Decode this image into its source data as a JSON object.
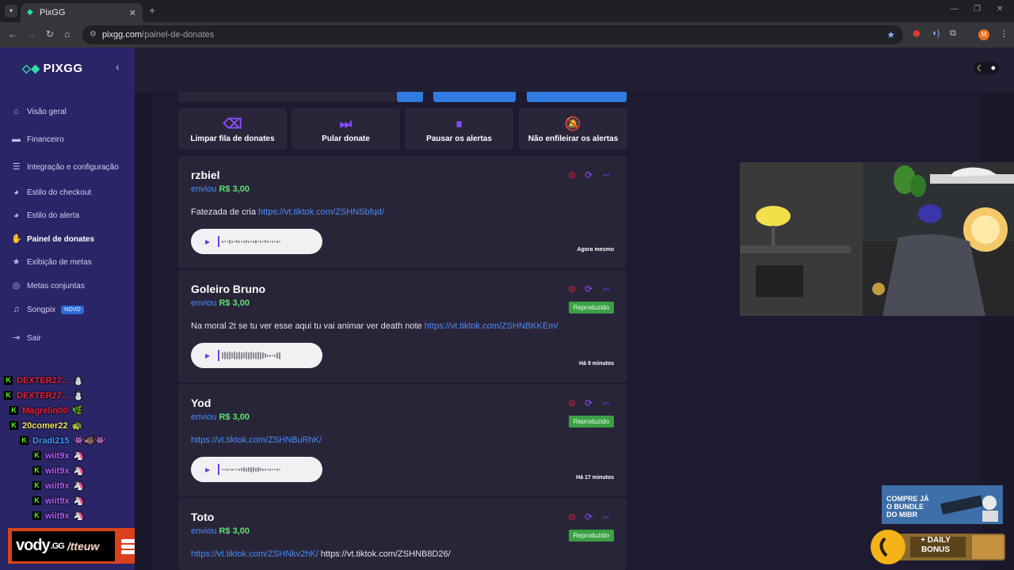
{
  "browser": {
    "tab_title": "PixGG",
    "url_host": "pixgg.com",
    "url_path": "/painel-de-donates",
    "profile_initial": "M"
  },
  "sidebar": {
    "brand": "PIXGG",
    "items": [
      {
        "label": "Visão geral",
        "icon": "home-icon"
      },
      {
        "label": "Financeiro",
        "icon": "wallet-icon"
      },
      {
        "label": "Integração e configuração",
        "icon": "settings-icon"
      },
      {
        "label": "Estilo do checkout",
        "icon": "palette-icon"
      },
      {
        "label": "Estilo do alerta",
        "icon": "palette-icon"
      },
      {
        "label": "Painel de donates",
        "icon": "donate-icon",
        "active": true
      },
      {
        "label": "Exibição de metas",
        "icon": "star-icon"
      },
      {
        "label": "Metas conjuntas",
        "icon": "target-icon"
      },
      {
        "label": "Songpix",
        "icon": "music-icon",
        "badge": "NOVO"
      },
      {
        "label": "Sair",
        "icon": "logout-icon"
      }
    ]
  },
  "actions": [
    {
      "label": "Limpar fila de donates",
      "icon": "eraser-icon"
    },
    {
      "label": "Pular donate",
      "icon": "skip-icon"
    },
    {
      "label": "Pausar os alertas",
      "icon": "pause-icon"
    },
    {
      "label": "Não enfileirar os alertas",
      "icon": "bell-off-icon"
    }
  ],
  "donates": [
    {
      "name": "rzbiel",
      "sent_prefix": "enviou",
      "amount": "R$ 3,00",
      "message": "Fatezada de cria ",
      "link": "https://vt.tiktok.com/ZSHNSbfqd/",
      "message_after": "",
      "time": "Agora mesmo",
      "status": ""
    },
    {
      "name": "Goleiro Bruno",
      "sent_prefix": "enviou",
      "amount": "R$ 3,00",
      "message": "Na moral 2t se tu ver esse aqui tu vai animar ver death note ",
      "link": "https://vt.tiktok.com/ZSHNBKKEm/",
      "message_after": "",
      "time": "Há 9 minutos",
      "status": "Reproduzido"
    },
    {
      "name": "Yod",
      "sent_prefix": "enviou",
      "amount": "R$ 3,00",
      "message": "",
      "link": "https://vt.tiktok.com/ZSHNBuRhK/",
      "message_after": "",
      "time": "Há 17 minutos",
      "status": "Reproduzido"
    },
    {
      "name": "Toto",
      "sent_prefix": "enviou",
      "amount": "R$ 3,00",
      "message": "",
      "link": "https://vt.tiktok.com/ZSHNkv2hK/",
      "message_after": " https://vt.tiktok.com/ZSHNB8D26/",
      "time": "",
      "status": "Reproduzido"
    }
  ],
  "chat": [
    {
      "user": "DEXTER27...",
      "color": "#e8213a",
      "emote": "⛄"
    },
    {
      "user": "DEXTER27...",
      "color": "#e8213a",
      "emote": "⛄"
    },
    {
      "user": "Magrelin00",
      "color": "#e8213a",
      "emote": "🌿"
    },
    {
      "user": "20comer22",
      "color": "#f5e46a",
      "emote": "🐢"
    },
    {
      "user": "Dradi215",
      "color": "#3a9dff",
      "emote": "👾🐗👾"
    },
    {
      "user": "wiit9x",
      "color": "#b45cff",
      "emote": "🦄"
    },
    {
      "user": "wiit9x",
      "color": "#b45cff",
      "emote": "🦄"
    },
    {
      "user": "wiit9x",
      "color": "#b45cff",
      "emote": "🦄"
    },
    {
      "user": "wiit9x",
      "color": "#b45cff",
      "emote": "🦄"
    },
    {
      "user": "wiit9x",
      "color": "#b45cff",
      "emote": "🦄"
    }
  ],
  "overlay": {
    "vody_brand": "vody",
    "vody_suffix": ".GG",
    "vody_handle": "/tteuw",
    "ad_text_1": "COMPRE JÁ",
    "ad_text_2": "O BUNDLE",
    "ad_text_3": "DO MIBR",
    "daily_bonus": "+ DAILY BONUS"
  },
  "colors": {
    "accent": "#8b4dff",
    "sidebar": "#2a2566",
    "link": "#4a8cf7",
    "amount": "#5ee073",
    "status": "#3aa144"
  }
}
